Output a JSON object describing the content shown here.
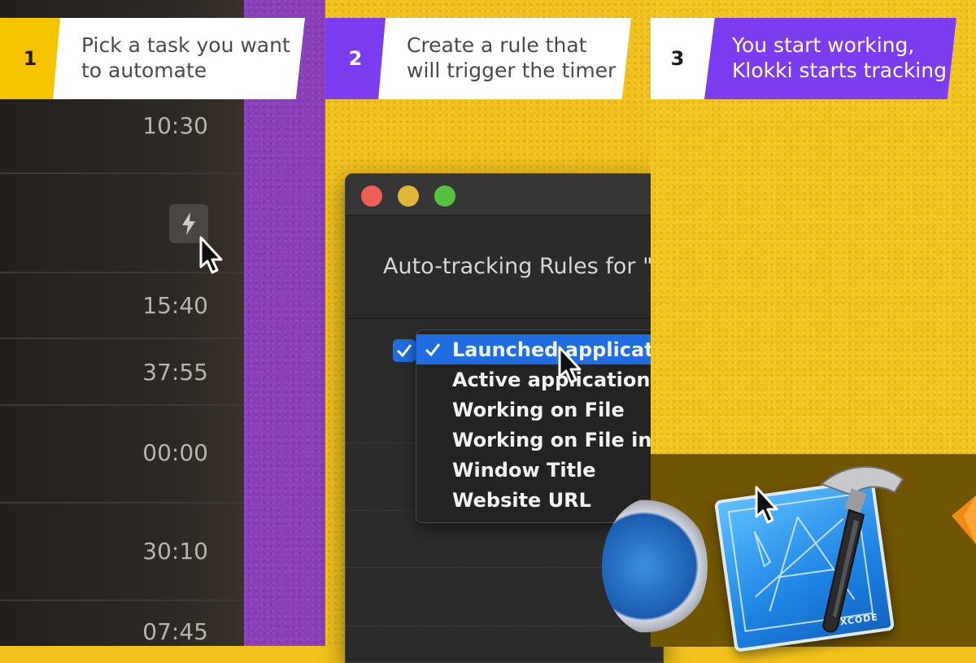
{
  "steps": [
    {
      "number": "1",
      "line1": "Pick a task you want",
      "line2": "to automate"
    },
    {
      "number": "2",
      "line1": "Create a rule that",
      "line2": "will trigger the timer"
    },
    {
      "number": "3",
      "line1": "You start working,",
      "line2": "Klokki starts tracking"
    }
  ],
  "task_list": {
    "times": [
      "10:30",
      "15:40",
      "37:55",
      "00:00",
      "30:10",
      "07:45"
    ],
    "auto_track_icon": "lightning-bolt-icon"
  },
  "rules_window": {
    "title": "Auto-tracking Rules for \"",
    "rule_enabled": true,
    "trigger_menu": {
      "selected": "Launched applicati",
      "items": [
        "Launched applicati",
        "Active application",
        "Working on File",
        "Working on File in F",
        "Window Title",
        "Website URL"
      ]
    }
  },
  "dock": {
    "apps": [
      "safari-icon",
      "xcode-icon",
      "sketch-icon"
    ],
    "xcode_label": "XCODE"
  },
  "colors": {
    "yellow": "#f5c400",
    "purple": "#7c3cf0",
    "menu_selection": "#1f6de0",
    "close": "#ec5f57",
    "minimize": "#e2b83a",
    "zoom": "#55c140"
  }
}
